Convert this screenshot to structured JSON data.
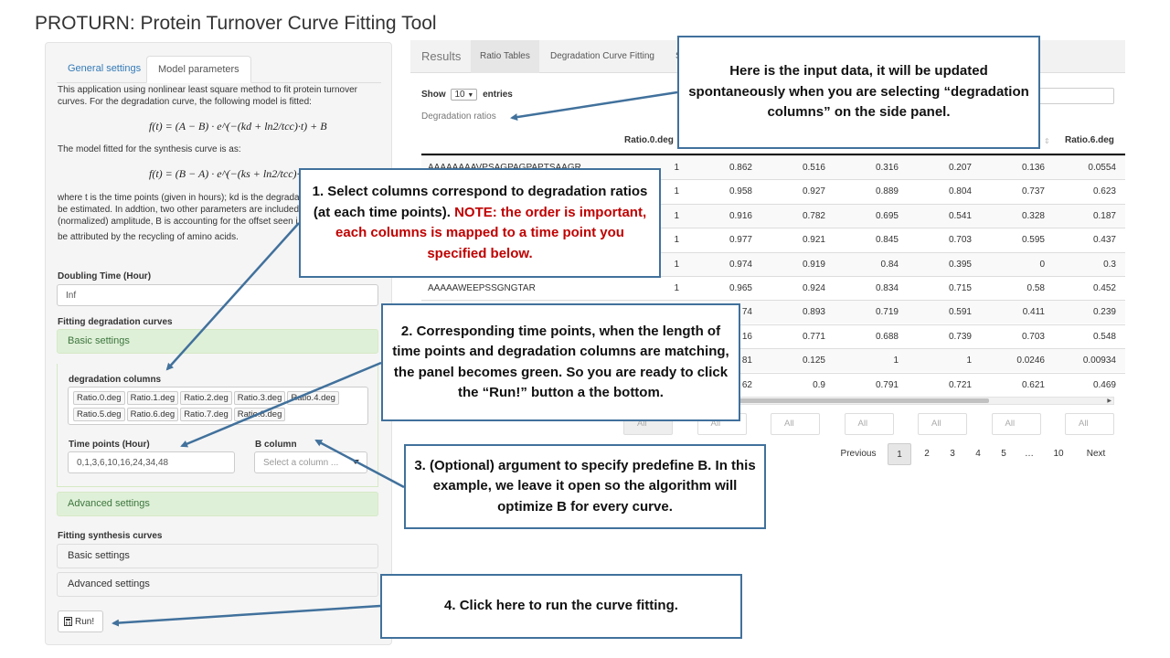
{
  "app": {
    "title": "PROTURN: Protein Turnover Curve Fitting Tool"
  },
  "sidebar": {
    "tabs": [
      {
        "label": "General settings"
      },
      {
        "label": "Model parameters"
      }
    ],
    "intro": "This application using nonlinear least square method to fit protein turnover curves. For the degradation curve, the following model is fitted:",
    "formula_deg": "f(t) = (A − B) · e^(−(kd + ln2/tcc)·t) + B",
    "synthesis_intro": "The model fitted for the synthesis curve is as:",
    "formula_syn": "f(t) = (B − A) · e^(−(ks + ln2/tcc)·t) + A",
    "explanation": [
      "where t is the time points (given in hours); kd is the degrada",
      "be estimated. In addtion, two other parameters are included",
      "(normalized) amplitude, B is accounting for the offset seen i",
      "be attributed by the recycling of amino acids."
    ],
    "doubling_time": {
      "label": "Doubling Time (Hour)",
      "value": "Inf"
    },
    "fitting_degradation": {
      "label": "Fitting degradation curves",
      "basic_settings": "Basic settings",
      "degradation_columns_label": "degradation columns",
      "degradation_columns": [
        "Ratio.0.deg",
        "Ratio.1.deg",
        "Ratio.2.deg",
        "Ratio.3.deg",
        "Ratio.4.deg",
        "Ratio.5.deg",
        "Ratio.6.deg",
        "Ratio.7.deg",
        "Ratio.8.deg"
      ],
      "time_points_label": "Time points (Hour)",
      "time_points_value": "0,1,3,6,10,16,24,34,48",
      "b_column_label": "B column",
      "b_column_placeholder": "Select a column ...",
      "advanced_settings": "Advanced settings"
    },
    "fitting_synthesis": {
      "label": "Fitting synthesis curves",
      "basic_settings": "Basic settings",
      "advanced_settings": "Advanced settings"
    },
    "run_button": "Run!"
  },
  "main": {
    "tabs": [
      {
        "label": "Results"
      },
      {
        "label": "Ratio Tables"
      },
      {
        "label": "Degradation Curve Fitting"
      },
      {
        "label": "S"
      }
    ],
    "show_label": "Show",
    "show_value": "10",
    "entries_label": "entries",
    "table_caption": "Degradation ratios",
    "columns": [
      "Ratio.0.deg",
      "Ratio.6.deg"
    ],
    "rows": [
      {
        "peptide": "AAAAAAAAVPSAGPAGPAPTSAAGR",
        "values": [
          "1",
          "0.862",
          "0.516",
          "0.316",
          "0.207",
          "0.136",
          "0.0554"
        ]
      },
      {
        "peptide": "",
        "values": [
          "1",
          "0.958",
          "0.927",
          "0.889",
          "0.804",
          "0.737",
          "0.623"
        ]
      },
      {
        "peptide": "",
        "values": [
          "1",
          "0.916",
          "0.782",
          "0.695",
          "0.541",
          "0.328",
          "0.187"
        ]
      },
      {
        "peptide": "",
        "values": [
          "1",
          "0.977",
          "0.921",
          "0.845",
          "0.703",
          "0.595",
          "0.437"
        ]
      },
      {
        "peptide": "",
        "values": [
          "1",
          "0.974",
          "0.919",
          "0.84",
          "0.395",
          "0",
          "0.3"
        ]
      },
      {
        "peptide": "AAAAAWEEPSSGNGTAR",
        "values": [
          "1",
          "0.965",
          "0.924",
          "0.834",
          "0.715",
          "0.58",
          "0.452"
        ]
      },
      {
        "peptide": "",
        "values": [
          "",
          "74",
          "0.893",
          "0.719",
          "0.591",
          "0.411",
          "0.239"
        ]
      },
      {
        "peptide": "",
        "values": [
          "",
          "16",
          "0.771",
          "0.688",
          "0.739",
          "0.703",
          "0.548"
        ]
      },
      {
        "peptide": "",
        "values": [
          "",
          "81",
          "0.125",
          "1",
          "1",
          "0.0246",
          "0.00934"
        ]
      },
      {
        "peptide": "",
        "values": [
          "",
          "62",
          "0.9",
          "0.791",
          "0.721",
          "0.621",
          "0.469"
        ]
      }
    ],
    "filter_placeholder": "All",
    "pagination": {
      "previous": "Previous",
      "pages": [
        "1",
        "2",
        "3",
        "4",
        "5",
        "…",
        "10"
      ],
      "next": "Next"
    }
  },
  "callouts": {
    "input_data": "Here is the input data, it will be updated spontaneously when you are selecting “degradation columns” on the side panel.",
    "step1_a": "1. Select columns correspond to degradation ratios (at each time points).",
    "step1_b": "NOTE: the order is important, each columns is mapped to a time point you specified below.",
    "step2": "2. Corresponding time points, when the length of time points and degradation columns are matching, the panel becomes green. So you are ready to click the “Run!” button a the bottom.",
    "step3": "3. (Optional) argument to specify predefine B. In this example, we leave it open so the algorithm will optimize B for every curve.",
    "step4": "4. Click here to run the curve fitting."
  },
  "colors": {
    "callout_border": "#41719c",
    "note_red": "#c00000",
    "success_green_bg": "#dff0d8",
    "link_blue": "#337ab7"
  }
}
